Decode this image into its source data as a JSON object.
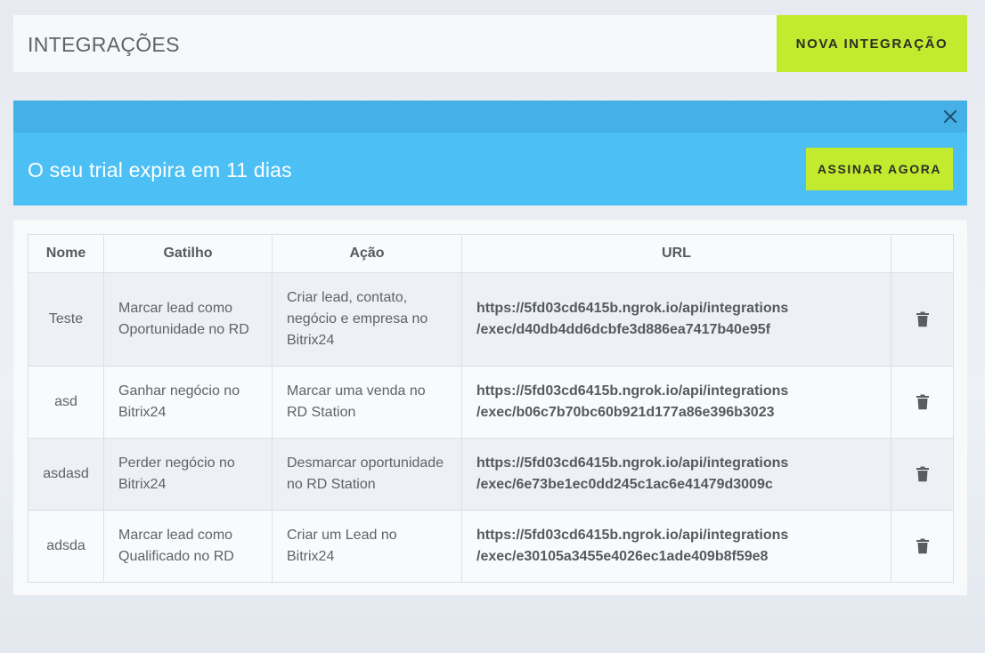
{
  "header": {
    "title": "INTEGRAÇÕES",
    "new_button": "NOVA INTEGRAÇÃO"
  },
  "alert": {
    "message": "O seu trial expira em 11 dias",
    "subscribe_button": "ASSINAR AGORA",
    "close_icon": "close-icon"
  },
  "table": {
    "headers": [
      "Nome",
      "Gatilho",
      "Ação",
      "URL",
      ""
    ],
    "rows": [
      {
        "name": "Teste",
        "trigger": "Marcar lead como Oportunidade no RD",
        "action": "Criar lead, contato, negócio e empresa no Bitrix24",
        "url_line1": "https://5fd03cd6415b.ngrok.io/api/integrations",
        "url_line2": "/exec/d40db4dd6dcbfe3d886ea7417b40e95f"
      },
      {
        "name": "asd",
        "trigger": "Ganhar negócio no Bitrix24",
        "action": "Marcar uma venda no RD Station",
        "url_line1": "https://5fd03cd6415b.ngrok.io/api/integrations",
        "url_line2": "/exec/b06c7b70bc60b921d177a86e396b3023"
      },
      {
        "name": "asdasd",
        "trigger": "Perder negócio no Bitrix24",
        "action": "Desmarcar oportunidade no RD Station",
        "url_line1": "https://5fd03cd6415b.ngrok.io/api/integrations",
        "url_line2": "/exec/6e73be1ec0dd245c1ac6e41479d3009c"
      },
      {
        "name": "adsda",
        "trigger": "Marcar lead como Qualificado no RD",
        "action": "Criar um Lead no Bitrix24",
        "url_line1": "https://5fd03cd6415b.ngrok.io/api/integrations",
        "url_line2": "/exec/e30105a3455e4026ec1ade409b8f59e8"
      }
    ]
  },
  "colors": {
    "accent_lime": "#c2ea2e",
    "alert_blue": "#4cc0f4",
    "alert_blue_dark": "#45b0e5"
  },
  "icons": {
    "delete": "trash-icon"
  }
}
